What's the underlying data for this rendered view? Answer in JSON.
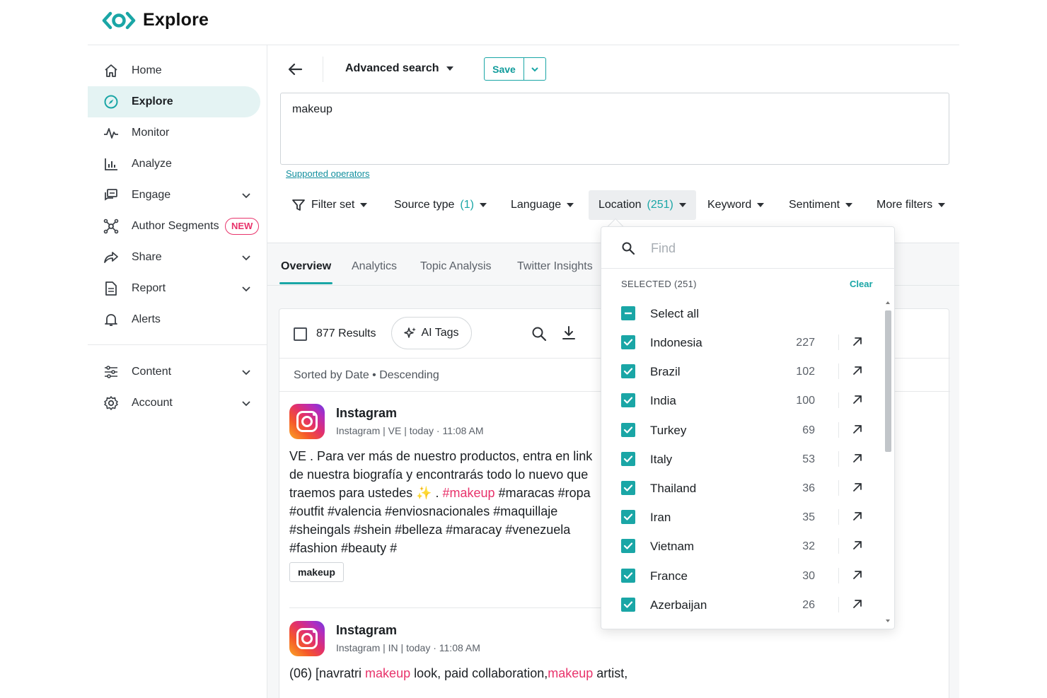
{
  "app": {
    "title": "Explore"
  },
  "sidebar": {
    "items": [
      {
        "label": "Home"
      },
      {
        "label": "Explore"
      },
      {
        "label": "Monitor"
      },
      {
        "label": "Analyze"
      },
      {
        "label": "Engage"
      },
      {
        "label": "Author Segments",
        "badge": "NEW"
      },
      {
        "label": "Share"
      },
      {
        "label": "Report"
      },
      {
        "label": "Alerts"
      },
      {
        "label": "Content"
      },
      {
        "label": "Account"
      }
    ]
  },
  "toolbar": {
    "title": "Advanced search",
    "save_label": "Save"
  },
  "query": {
    "text": "makeup",
    "operators_link": "Supported operators"
  },
  "filters": {
    "filter_set": "Filter set",
    "source_type": "Source type",
    "source_type_count": "(1)",
    "language": "Language",
    "location": "Location",
    "location_count": "(251)",
    "keyword": "Keyword",
    "sentiment": "Sentiment",
    "more_filters": "More filters"
  },
  "tabs": [
    "Overview",
    "Analytics",
    "Topic Analysis",
    "Twitter Insights"
  ],
  "results": {
    "count_label": "877 Results",
    "ai_tags_label": "AI Tags",
    "sorted_label": "Sorted by Date • Descending"
  },
  "posts": [
    {
      "source": "Instagram",
      "meta": "Instagram | VE | today · 11:08 AM",
      "body_1": "VE . Para ver más de nuestro productos, entra en link de nuestra biografía y encontrarás todo lo nuevo que traemos para ustedes ✨ . ",
      "hl_1": "#makeup",
      "body_2": " #maracas #ropa #outfit #valencia #enviosnacionales #maquillaje #sheingals #shein #belleza #maracay #venezuela #fashion #beauty #",
      "tag": "makeup"
    },
    {
      "source": "Instagram",
      "meta": "Instagram | IN | today · 11:08 AM",
      "body_1": "(06) [navratri ",
      "hl_1": "makeup",
      "body_2": " look, paid collaboration,",
      "hl_2": "makeup",
      "body_3": " artist,"
    }
  ],
  "location_dropdown": {
    "find_placeholder": "Find",
    "selected_label": "SELECTED (251)",
    "clear_label": "Clear",
    "select_all_label": "Select all",
    "options": [
      {
        "label": "Indonesia",
        "count": "227"
      },
      {
        "label": "Brazil",
        "count": "102"
      },
      {
        "label": "India",
        "count": "100"
      },
      {
        "label": "Turkey",
        "count": "69"
      },
      {
        "label": "Italy",
        "count": "53"
      },
      {
        "label": "Thailand",
        "count": "36"
      },
      {
        "label": "Iran",
        "count": "35"
      },
      {
        "label": "Vietnam",
        "count": "32"
      },
      {
        "label": "France",
        "count": "30"
      },
      {
        "label": "Azerbaijan",
        "count": "26"
      }
    ]
  },
  "colors": {
    "accent": "#1aa6a6",
    "highlight": "#e8336b",
    "active_nav_bg": "#e4f3f3"
  },
  "icons": [
    "logo-icon",
    "home-icon",
    "explore-icon",
    "monitor-icon",
    "analyze-icon",
    "engage-icon",
    "author-segments-icon",
    "share-icon",
    "report-icon",
    "alerts-icon",
    "content-icon",
    "account-icon",
    "back-arrow-icon",
    "filter-icon",
    "search-icon",
    "download-icon",
    "sparkle-icon",
    "checkbox-checked-icon",
    "external-link-icon"
  ]
}
